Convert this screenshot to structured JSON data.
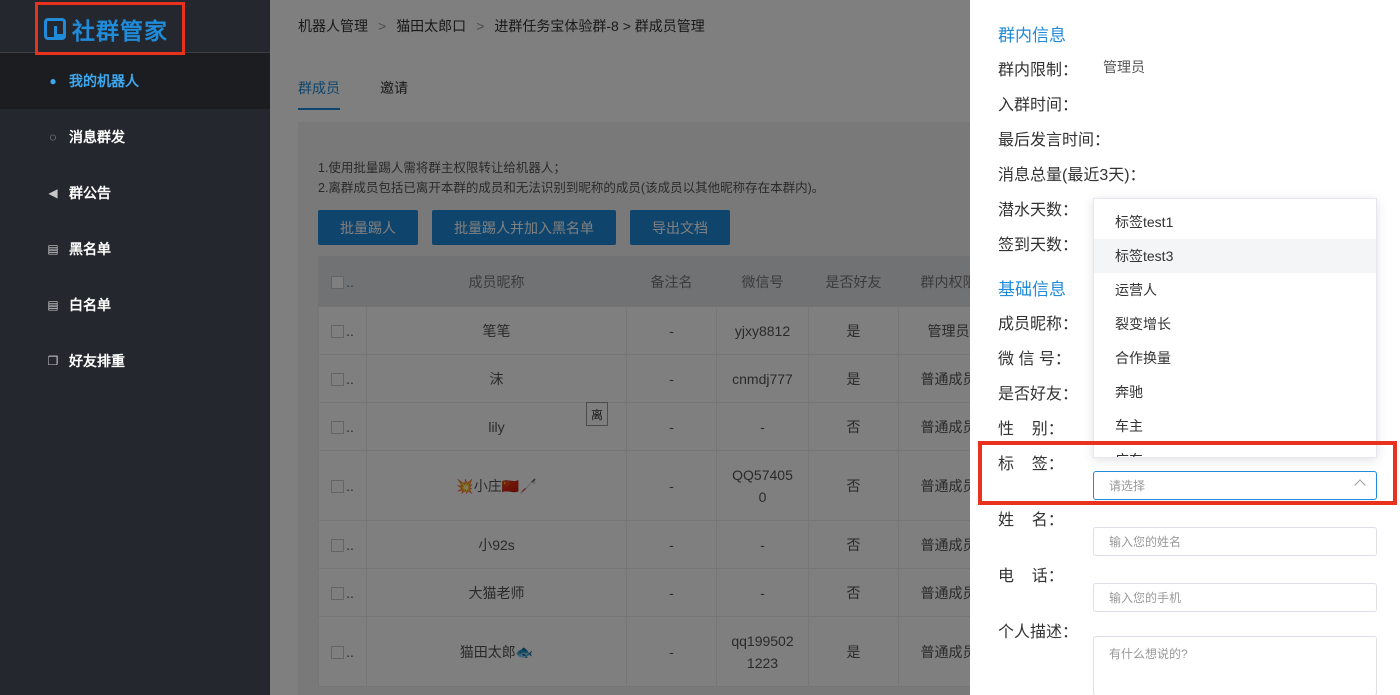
{
  "logo": {
    "text": "社群管家"
  },
  "sidebar": {
    "items": [
      {
        "label": "我的机器人",
        "icon": "user-circle-icon",
        "active": true
      },
      {
        "label": "消息群发",
        "icon": "chat-bubble-icon"
      },
      {
        "label": "群公告",
        "icon": "megaphone-icon"
      },
      {
        "label": "黑名单",
        "icon": "id-card-icon"
      },
      {
        "label": "白名单",
        "icon": "id-card-icon"
      },
      {
        "label": "好友排重",
        "icon": "copy-icon"
      }
    ]
  },
  "breadcrumb": {
    "items": [
      "机器人管理",
      "猫田太郎口",
      "进群任务宝体验群-8 > 群成员管理"
    ]
  },
  "tabs": {
    "members": "群成员",
    "invite": "邀请"
  },
  "notes": {
    "line1": "1.使用批量踢人需将群主权限转让给机器人；",
    "line2": "2.离群成员包括已离开本群的成员和无法识别到昵称的成员(该成员以其他昵称存在本群内)。"
  },
  "buttons": {
    "batch_kick": "批量踢人",
    "batch_kick_blacklist": "批量踢人并加入黑名单",
    "export": "导出文档"
  },
  "table": {
    "headers": [
      "成员昵称",
      "备注名",
      "微信号",
      "是否好友",
      "群内权限"
    ],
    "rows": [
      {
        "nickname": "笔笔",
        "remark": "-",
        "wechat": "yjxy8812",
        "friend": "是",
        "role": "管理员"
      },
      {
        "nickname": "沫",
        "remark": "-",
        "wechat": "cnmdj777",
        "friend": "是",
        "role": "普通成员"
      },
      {
        "nickname": "lily",
        "remark": "-",
        "wechat": "-",
        "friend": "否",
        "role": "普通成员"
      },
      {
        "nickname": "💥小庄🇨🇳🦯",
        "remark": "-",
        "wechat": "QQ57405 0",
        "friend": "否",
        "role": "普通成员"
      },
      {
        "nickname": "小92s",
        "remark": "-",
        "wechat": "-",
        "friend": "否",
        "role": "普通成员"
      },
      {
        "nickname": "大猫老师",
        "remark": "-",
        "wechat": "-",
        "friend": "否",
        "role": "普通成员"
      },
      {
        "nickname": "猫田太郎🐟",
        "remark": "-",
        "wechat": "qq199502 1223",
        "friend": "是",
        "role": "普通成员"
      }
    ],
    "badge": "离"
  },
  "drawer": {
    "group_info_title": "群内信息",
    "group_limit_label": "群内限制：",
    "group_limit_value": "管理员",
    "join_time_label": "入群时间：",
    "last_speak_label": "最后发言时间：",
    "msg_total_label": "消息总量(最近3天)：",
    "lurk_days_label": "潜水天数：",
    "checkin_days_label": "签到天数：",
    "basic_info_title": "基础信息",
    "nickname_label": "成员昵称：",
    "wechat_label": "微 信 号：",
    "friend_label": "是否好友：",
    "gender_label": "性    别：",
    "tag_label": "标    签：",
    "name_label": "姓    名：",
    "phone_label": "电    话：",
    "desc_label": "个人描述：",
    "tag_placeholder": "请选择",
    "name_placeholder": "输入您的姓名",
    "phone_placeholder": "输入您的手机",
    "desc_placeholder": "有什么想说的?",
    "tag_options": [
      "标签test1",
      "标签test3",
      "运营人",
      "裂变增长",
      "合作换量",
      "奔驰",
      "车主",
      "广东"
    ]
  }
}
